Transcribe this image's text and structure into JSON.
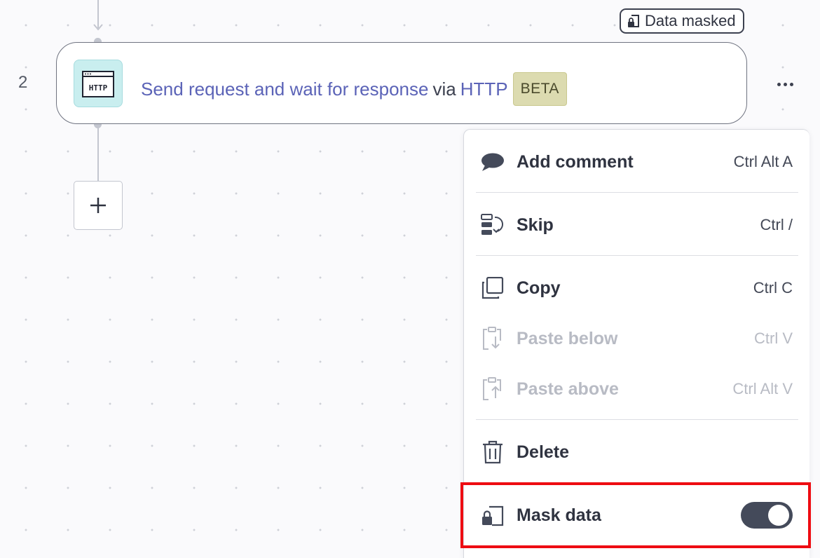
{
  "step": {
    "number": "2",
    "app_icon_text": "HTTP",
    "action": "Send request and wait for response",
    "via": "via",
    "app": "HTTP",
    "badge": "BETA",
    "masked_label": "Data masked"
  },
  "menu": {
    "items": [
      {
        "label": "Add comment",
        "shortcut": "Ctrl Alt A",
        "icon": "comment-icon",
        "enabled": true
      },
      {
        "label": "Skip",
        "shortcut": "Ctrl /",
        "icon": "skip-icon",
        "enabled": true
      },
      {
        "label": "Copy",
        "shortcut": "Ctrl C",
        "icon": "copy-icon",
        "enabled": true
      },
      {
        "label": "Paste below",
        "shortcut": "Ctrl V",
        "icon": "paste-below-icon",
        "enabled": false
      },
      {
        "label": "Paste above",
        "shortcut": "Ctrl Alt V",
        "icon": "paste-above-icon",
        "enabled": false
      },
      {
        "label": "Delete",
        "shortcut": "",
        "icon": "trash-icon",
        "enabled": true
      },
      {
        "label": "Mask data",
        "shortcut": "",
        "icon": "lock-document-icon",
        "enabled": true,
        "toggle_on": true
      }
    ]
  },
  "colors": {
    "accent": "#5b63b7",
    "highlight": "#ee0c12",
    "toggle_on": "#444a5a",
    "app_tile": "#c9eeef",
    "beta_badge": "#dcdbb0"
  }
}
